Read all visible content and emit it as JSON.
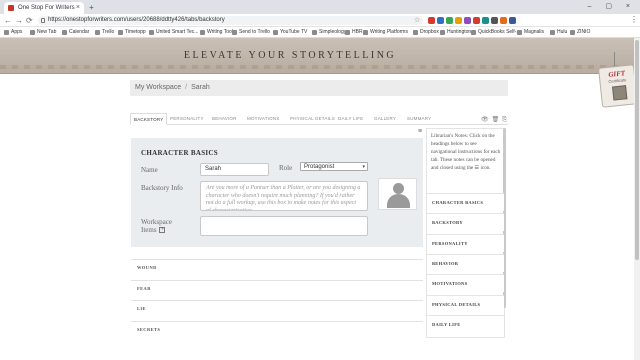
{
  "browser": {
    "tab_title": "One Stop For Writers",
    "tab_close": "×",
    "new_tab": "+",
    "window_controls": "–  ▢  ×",
    "url": "https://onestopforwriters.com/users/20688/ddtty426/tabs/backstory",
    "back": "←",
    "forward": "→",
    "reload": "⟳",
    "star": "☆",
    "menu": "⋮",
    "extension_colors": [
      "#d33b2c",
      "#2f6fc6",
      "#34a853",
      "#e6a100",
      "#8a4fb8",
      "#d33b2c",
      "#1a8f8f",
      "#555555",
      "#e36b1d",
      "#3b5998"
    ],
    "bookmarks": [
      "Apps",
      "New Tab",
      "Calendar",
      "Trello",
      "Timetopp",
      "United Smart Tec...",
      "Writing Tools",
      "Send to Trello",
      "YouTube TV",
      "Simpleology",
      "HBR",
      "Writing Platforms",
      "Dropbox",
      "Huntington",
      "QuickBooks Self-...",
      "Magnalis",
      "Hulu",
      "ZINIO"
    ]
  },
  "site": {
    "banner_title": "ELEVATE YOUR STORYTELLING",
    "gift": {
      "label": "GIFT",
      "sub": "Certificate"
    }
  },
  "breadcrumb": {
    "workspace": "My Workspace",
    "separator": "/",
    "current": "Sarah"
  },
  "tabs": [
    {
      "label": "BACKSTORY",
      "active": true
    },
    {
      "label": "PERSONALITY",
      "active": false
    },
    {
      "label": "BEHAVIOR",
      "active": false
    },
    {
      "label": "MOTIVATIONS",
      "active": false
    },
    {
      "label": "PHYSICAL DETAILS",
      "active": false
    },
    {
      "label": "DAILY LIFE",
      "active": false
    },
    {
      "label": "GALLERY",
      "active": false
    },
    {
      "label": "SUMMARY",
      "active": false
    }
  ],
  "tab_actions": {
    "view": "👁",
    "delete": "🗑",
    "copy": "⎘"
  },
  "form": {
    "menu_icon": "≡",
    "section_title": "CHARACTER BASICS",
    "name_label": "Name",
    "name_value": "Sarah",
    "role_label": "Role",
    "role_value": "Protagonist",
    "role_arrow": "▾",
    "backstory_label": "Backstory Info",
    "backstory_placeholder": "Are you more of a Pantser than a Plotter, or are you designing a character who doesn't require much planning? If you'd rather not do a full workup, use this box to make notes for this aspect of characterization.",
    "workspace_label_1": "Workspace",
    "workspace_label_2": "Items",
    "workspace_plus": "+",
    "workspace_value": ""
  },
  "collapsed_sections": [
    "WOUND",
    "FEAR",
    "LIE",
    "SECRETS"
  ],
  "sidebar": {
    "note": "Librarian's Notes: Click on the headings below to see navigational instructions for each tab. These notes can be opened and closed using the ☰ icon.",
    "items": [
      "CHARACTER BASICS",
      "BACKSTORY",
      "PERSONALITY",
      "BEHAVIOR",
      "MOTIVATIONS",
      "PHYSICAL DETAILS",
      "DAILY LIFE"
    ]
  }
}
